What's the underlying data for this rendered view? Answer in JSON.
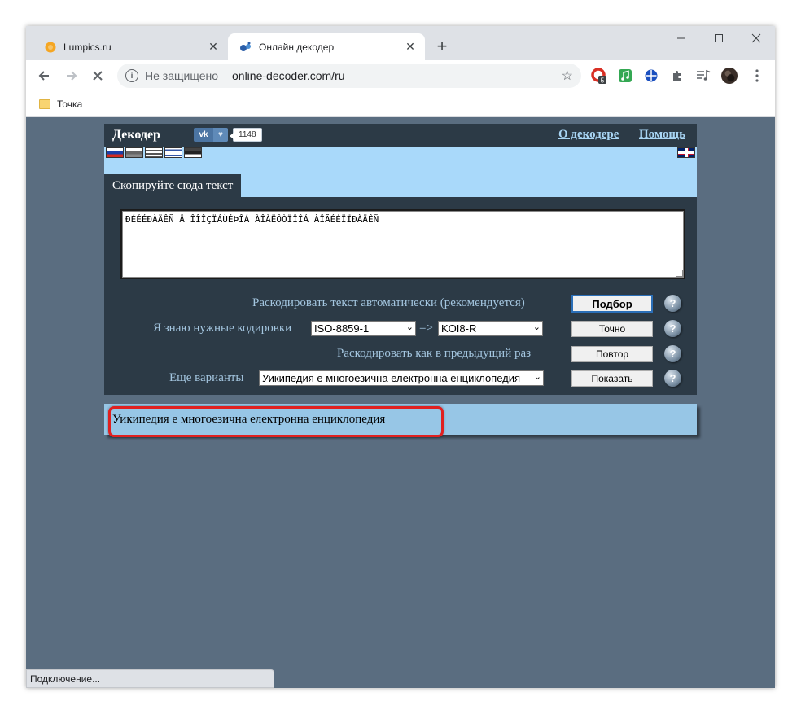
{
  "tabs": [
    {
      "label": "Lumpics.ru",
      "icon": "orange-circle-icon"
    },
    {
      "label": "Онлайн декодер",
      "icon": "decoder-logo-icon"
    }
  ],
  "toolbar": {
    "security_label": "Не защищено",
    "url": "online-decoder.com/ru",
    "ext_badge": "5"
  },
  "bookmarks": [
    {
      "label": "Точка"
    }
  ],
  "page": {
    "title": "Декодер",
    "vk_label": "vk",
    "like_count": "1148",
    "link_about": "О декодере",
    "link_help": "Помощь",
    "tab_label": "Скопируйте сюда текст",
    "input_text": "ÐÉÉÉÐÀÄÊÑ Â ÎÎÎÇÏÁÙÉÞÎÁ ÀÎÀËÔÒÏÎÎÁ ÀÎÃÉÉÏÏÐÀÄÊÑ",
    "rows": {
      "auto_label": "Раскодировать текст автоматически (рекомендуется)",
      "auto_button": "Подбор",
      "know_label": "Я знаю нужные кодировки",
      "from_encoding": "ISO-8859-1",
      "arrow": "=>",
      "to_encoding": "KOI8-R",
      "exact_button": "Точно",
      "repeat_label": "Раскодировать как в предыдущий раз",
      "repeat_button": "Повтор",
      "more_label": "Еще варианты",
      "variant_selected": "Уикипедия е многоезична електронна енциклопедия",
      "show_button": "Показать",
      "help": "?"
    },
    "result_text": "Уикипедия е многоезична електронна енциклопедия"
  },
  "status_text": "Подключение...",
  "colors": {
    "page_bg": "#5a6d80",
    "panel_bg": "#2c3a46",
    "flagbar_bg": "#a9d9fa",
    "result_bg": "#97c6e6",
    "highlight": "#e02020",
    "link": "#a9d6f5"
  }
}
